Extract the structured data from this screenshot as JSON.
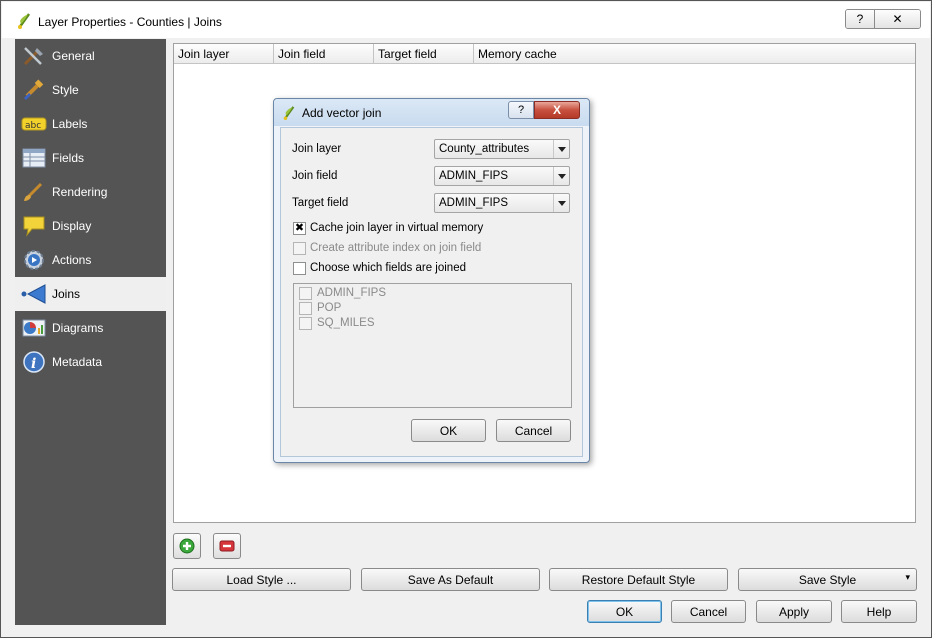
{
  "window": {
    "title": "Layer Properties - Counties | Joins",
    "help_glyph": "?",
    "close_glyph": "✕"
  },
  "sidebar": {
    "items": [
      {
        "label": "General",
        "icon": "tools-icon"
      },
      {
        "label": "Style",
        "icon": "paintbrush-icon"
      },
      {
        "label": "Labels",
        "icon": "abc-label-icon"
      },
      {
        "label": "Fields",
        "icon": "table-icon"
      },
      {
        "label": "Rendering",
        "icon": "brush-icon"
      },
      {
        "label": "Display",
        "icon": "speech-bubble-icon"
      },
      {
        "label": "Actions",
        "icon": "gear-play-icon"
      },
      {
        "label": "Joins",
        "icon": "join-arrow-icon",
        "active": true
      },
      {
        "label": "Diagrams",
        "icon": "diagram-icon"
      },
      {
        "label": "Metadata",
        "icon": "info-icon"
      }
    ]
  },
  "joins_table": {
    "columns": [
      "Join layer",
      "Join field",
      "Target field",
      "Memory cache"
    ]
  },
  "buttons": {
    "load_style": "Load Style ...",
    "save_default": "Save As Default",
    "restore_default": "Restore Default Style",
    "save_style": "Save Style",
    "ok": "OK",
    "cancel": "Cancel",
    "apply": "Apply",
    "help": "Help"
  },
  "dialog": {
    "title": "Add vector join",
    "help_glyph": "?",
    "close_glyph": "X",
    "join_layer_label": "Join layer",
    "join_layer_value": "County_attributes",
    "join_field_label": "Join field",
    "join_field_value": "ADMIN_FIPS",
    "target_field_label": "Target field",
    "target_field_value": "ADMIN_FIPS",
    "cache_label": "Cache join layer in virtual memory",
    "cache_checked": true,
    "index_label": "Create attribute index on join field",
    "choose_label": "Choose which fields are joined",
    "fields": [
      "ADMIN_FIPS",
      "POP",
      "SQ_MILES"
    ],
    "ok": "OK",
    "cancel": "Cancel"
  },
  "colors": {
    "sidebar_bg": "#545454",
    "active_item_bg": "#efefef",
    "add_icon": "#2e9c2e",
    "remove_icon": "#c0262c"
  }
}
